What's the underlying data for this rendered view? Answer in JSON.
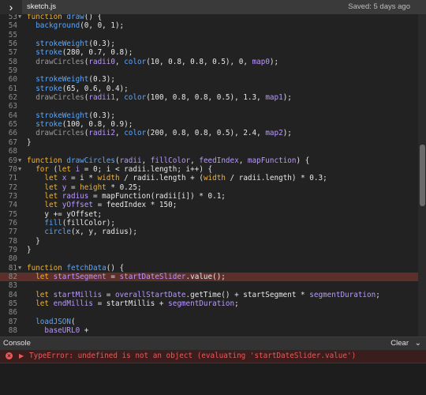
{
  "topbar": {
    "expand_icon": "chevron-right-icon",
    "expand_glyph": "›",
    "filename": "sketch.js",
    "saved": "Saved: 5 days ago"
  },
  "editor": {
    "lines": [
      {
        "n": "53",
        "fold": true,
        "tokens": [
          [
            "kw",
            "function "
          ],
          [
            "fn",
            "draw"
          ],
          [
            "",
            "() {"
          ]
        ]
      },
      {
        "n": "54",
        "tokens": [
          [
            "",
            "  "
          ],
          [
            "fn",
            "background"
          ],
          [
            "",
            "(0, 0, 1);"
          ]
        ]
      },
      {
        "n": "55",
        "tokens": []
      },
      {
        "n": "56",
        "tokens": [
          [
            "",
            "  "
          ],
          [
            "fn",
            "strokeWeight"
          ],
          [
            "",
            "(0.3);"
          ]
        ]
      },
      {
        "n": "57",
        "tokens": [
          [
            "",
            "  "
          ],
          [
            "fn",
            "stroke"
          ],
          [
            "",
            "(280, 0.7, 0.8);"
          ]
        ]
      },
      {
        "n": "58",
        "tokens": [
          [
            "",
            "  "
          ],
          [
            "cm",
            "drawCircles"
          ],
          [
            "",
            "("
          ],
          [
            "pu",
            "radii0"
          ],
          [
            "",
            ", "
          ],
          [
            "fn",
            "color"
          ],
          [
            "",
            "(10, 0.8, 0.8, 0.5), 0, "
          ],
          [
            "pu",
            "map0"
          ],
          [
            "",
            ");"
          ]
        ]
      },
      {
        "n": "59",
        "tokens": []
      },
      {
        "n": "60",
        "tokens": [
          [
            "",
            "  "
          ],
          [
            "fn",
            "strokeWeight"
          ],
          [
            "",
            "(0.3);"
          ]
        ]
      },
      {
        "n": "61",
        "tokens": [
          [
            "",
            "  "
          ],
          [
            "fn",
            "stroke"
          ],
          [
            "",
            "(65, 0.6, 0.4);"
          ]
        ]
      },
      {
        "n": "62",
        "tokens": [
          [
            "",
            "  "
          ],
          [
            "cm",
            "drawCircles"
          ],
          [
            "",
            "("
          ],
          [
            "pu",
            "radii1"
          ],
          [
            "",
            ", "
          ],
          [
            "fn",
            "color"
          ],
          [
            "",
            "(100, 0.8, 0.8, 0.5), 1.3, "
          ],
          [
            "pu",
            "map1"
          ],
          [
            "",
            ");"
          ]
        ]
      },
      {
        "n": "63",
        "tokens": []
      },
      {
        "n": "64",
        "tokens": [
          [
            "",
            "  "
          ],
          [
            "fn",
            "strokeWeight"
          ],
          [
            "",
            "(0.3);"
          ]
        ]
      },
      {
        "n": "65",
        "tokens": [
          [
            "",
            "  "
          ],
          [
            "fn",
            "stroke"
          ],
          [
            "",
            "(100, 0.8, 0.9);"
          ]
        ]
      },
      {
        "n": "66",
        "tokens": [
          [
            "",
            "  "
          ],
          [
            "cm",
            "drawCircles"
          ],
          [
            "",
            "("
          ],
          [
            "pu",
            "radii2"
          ],
          [
            "",
            ", "
          ],
          [
            "fn",
            "color"
          ],
          [
            "",
            "(200, 0.8, 0.8, 0.5), 2.4, "
          ],
          [
            "pu",
            "map2"
          ],
          [
            "",
            ");"
          ]
        ]
      },
      {
        "n": "67",
        "tokens": [
          [
            "",
            "}"
          ]
        ]
      },
      {
        "n": "68",
        "tokens": []
      },
      {
        "n": "69",
        "fold": true,
        "tokens": [
          [
            "kw",
            "function "
          ],
          [
            "fn",
            "drawCircles"
          ],
          [
            "",
            "("
          ],
          [
            "pu",
            "radii"
          ],
          [
            "",
            ", "
          ],
          [
            "pu",
            "fillColor"
          ],
          [
            "",
            ", "
          ],
          [
            "pu",
            "feedIndex"
          ],
          [
            "",
            ", "
          ],
          [
            "pu",
            "mapFunction"
          ],
          [
            "",
            ") {"
          ]
        ]
      },
      {
        "n": "70",
        "fold": true,
        "tokens": [
          [
            "",
            "  "
          ],
          [
            "kw",
            "for "
          ],
          [
            "",
            "("
          ],
          [
            "kw",
            "let "
          ],
          [
            "pu",
            "i"
          ],
          [
            "",
            " = 0; i < radii.length; i++) {"
          ]
        ]
      },
      {
        "n": "71",
        "tokens": [
          [
            "",
            "    "
          ],
          [
            "kw",
            "let "
          ],
          [
            "pu",
            "x"
          ],
          [
            "",
            " = i * "
          ],
          [
            "kw",
            "width"
          ],
          [
            "",
            " / radii.length + ("
          ],
          [
            "kw",
            "width"
          ],
          [
            "",
            " / radii.length) * 0.3;"
          ]
        ]
      },
      {
        "n": "72",
        "tokens": [
          [
            "",
            "    "
          ],
          [
            "kw",
            "let "
          ],
          [
            "pu",
            "y"
          ],
          [
            "",
            " = "
          ],
          [
            "kw",
            "height"
          ],
          [
            "",
            " * 0.25;"
          ]
        ]
      },
      {
        "n": "73",
        "tokens": [
          [
            "",
            "    "
          ],
          [
            "kw",
            "let "
          ],
          [
            "pu",
            "radius"
          ],
          [
            "",
            " = mapFunction(radii[i]) * 0.1;"
          ]
        ]
      },
      {
        "n": "74",
        "tokens": [
          [
            "",
            "    "
          ],
          [
            "kw",
            "let "
          ],
          [
            "pu",
            "yOffset"
          ],
          [
            "",
            " = feedIndex * 150;"
          ]
        ]
      },
      {
        "n": "75",
        "tokens": [
          [
            "",
            "    y += yOffset;"
          ]
        ]
      },
      {
        "n": "76",
        "tokens": [
          [
            "",
            "    "
          ],
          [
            "fn",
            "fill"
          ],
          [
            "",
            "(fillColor);"
          ]
        ]
      },
      {
        "n": "77",
        "tokens": [
          [
            "",
            "    "
          ],
          [
            "fn",
            "circle"
          ],
          [
            "",
            "(x, y, radius);"
          ]
        ]
      },
      {
        "n": "78",
        "tokens": [
          [
            "",
            "  }"
          ]
        ]
      },
      {
        "n": "79",
        "tokens": [
          [
            "",
            "}"
          ]
        ]
      },
      {
        "n": "80",
        "tokens": []
      },
      {
        "n": "81",
        "fold": true,
        "tokens": [
          [
            "kw",
            "function "
          ],
          [
            "fn",
            "fetchData"
          ],
          [
            "",
            "() {"
          ]
        ]
      },
      {
        "n": "82",
        "highlight": true,
        "tokens": [
          [
            "",
            "  "
          ],
          [
            "kw",
            "let "
          ],
          [
            "pu",
            "startSegment"
          ],
          [
            "",
            " = "
          ],
          [
            "pu",
            "startDateSlider"
          ],
          [
            "",
            ".value();"
          ]
        ]
      },
      {
        "n": "83",
        "tokens": []
      },
      {
        "n": "84",
        "tokens": [
          [
            "",
            "  "
          ],
          [
            "kw",
            "let "
          ],
          [
            "pu",
            "startMillis"
          ],
          [
            "",
            " = "
          ],
          [
            "pu",
            "overallStartDate"
          ],
          [
            "",
            ".getTime() + startSegment * "
          ],
          [
            "pu",
            "segmentDuration"
          ],
          [
            "",
            ";"
          ]
        ]
      },
      {
        "n": "85",
        "tokens": [
          [
            "",
            "  "
          ],
          [
            "kw",
            "let "
          ],
          [
            "pu",
            "endMillis"
          ],
          [
            "",
            " = startMillis + "
          ],
          [
            "pu",
            "segmentDuration"
          ],
          [
            "",
            ";"
          ]
        ]
      },
      {
        "n": "86",
        "tokens": []
      },
      {
        "n": "87",
        "tokens": [
          [
            "",
            "  "
          ],
          [
            "fn",
            "loadJSON"
          ],
          [
            "",
            "("
          ]
        ]
      },
      {
        "n": "88",
        "tokens": [
          [
            "",
            "    "
          ],
          [
            "pu",
            "baseURL0"
          ],
          [
            "",
            " +"
          ]
        ]
      }
    ],
    "scroll_position": 0.5,
    "scroll_visible_fraction": 0.25
  },
  "console": {
    "title": "Console",
    "clear_label": "Clear",
    "collapse_icon": "chevron-down-icon",
    "collapse_glyph": "⌄",
    "error": {
      "icon": "error-icon",
      "icon_glyph": "×",
      "caret_glyph": "▶",
      "message": "TypeError: undefined is not an object (evaluating 'startDateSlider.value')"
    }
  },
  "colors": {
    "keyword": "#f2b234",
    "function": "#5aa7ff",
    "variable": "#b998ff",
    "error": "#e85a5a",
    "highlight_line": "#5c2f2b"
  }
}
